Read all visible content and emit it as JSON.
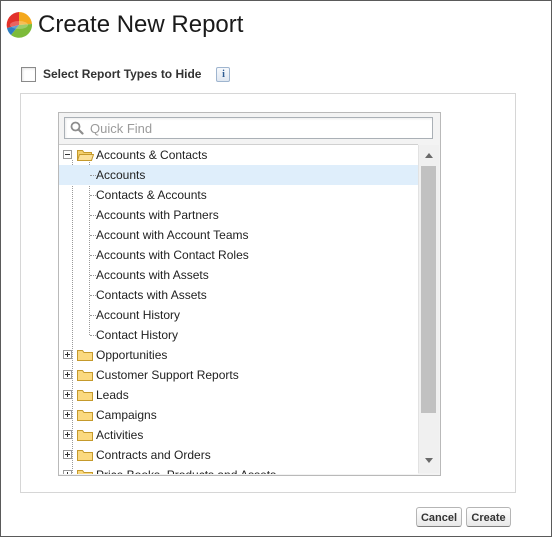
{
  "page": {
    "title": "Create New Report"
  },
  "hide_types": {
    "label": "Select Report Types to Hide",
    "checked": false,
    "info_label": "i"
  },
  "search": {
    "placeholder": "Quick Find",
    "value": ""
  },
  "tree": {
    "categories": [
      {
        "label": "Accounts & Contacts",
        "expanded": true
      },
      {
        "label": "Opportunities",
        "expanded": false
      },
      {
        "label": "Customer Support Reports",
        "expanded": false
      },
      {
        "label": "Leads",
        "expanded": false
      },
      {
        "label": "Campaigns",
        "expanded": false
      },
      {
        "label": "Activities",
        "expanded": false
      },
      {
        "label": "Contracts and Orders",
        "expanded": false
      },
      {
        "label": "Price Books, Products and Assets",
        "expanded": false
      }
    ],
    "children": [
      {
        "label": "Accounts",
        "selected": true
      },
      {
        "label": "Contacts & Accounts",
        "selected": false
      },
      {
        "label": "Accounts with Partners",
        "selected": false
      },
      {
        "label": "Account with Account Teams",
        "selected": false
      },
      {
        "label": "Accounts with Contact Roles",
        "selected": false
      },
      {
        "label": "Accounts with Assets",
        "selected": false
      },
      {
        "label": "Contacts with Assets",
        "selected": false
      },
      {
        "label": "Account History",
        "selected": false
      },
      {
        "label": "Contact History",
        "selected": false
      }
    ]
  },
  "buttons": {
    "cancel": "Cancel",
    "create": "Create"
  }
}
